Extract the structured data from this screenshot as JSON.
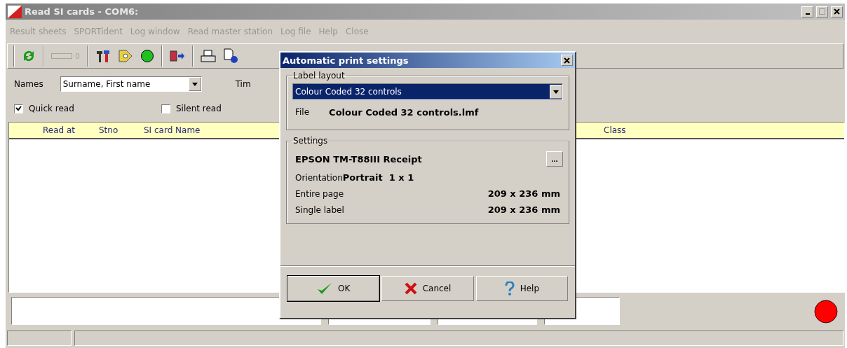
{
  "window": {
    "title": "Read SI cards - COM6:"
  },
  "menu": [
    "Result sheets",
    "SPORTident",
    "Log window",
    "Read master station",
    "Log file",
    "Help",
    "Close"
  ],
  "toolbar": {
    "counter": "0"
  },
  "options": {
    "names_label": "Names",
    "names_value": "Surname, First name",
    "time_label": "Tim",
    "checkboxes": [
      {
        "label": "Quick read",
        "checked": true
      },
      {
        "label": "Silent read",
        "checked": false
      }
    ]
  },
  "table": {
    "columns": [
      "Read at",
      "Stno",
      "SI card Name",
      "Class"
    ]
  },
  "status_light": {
    "color": "#ff0000"
  },
  "dialog": {
    "title": "Automatic print settings",
    "label_layout": {
      "legend": "Label layout",
      "value": "Colour Coded 32 controls",
      "file_label": "File",
      "file_value": "Colour Coded 32 controls.lmf"
    },
    "settings": {
      "legend": "Settings",
      "printer": "EPSON TM-T88III Receipt",
      "browse": "...",
      "orientation_label": "Orientation",
      "orientation_value": "Portrait  1 x 1",
      "rows": [
        {
          "label": "Entire page",
          "value": "209 x 236 mm"
        },
        {
          "label": "Single label",
          "value": "209 x 236 mm"
        }
      ]
    },
    "buttons": [
      {
        "kind": "ok",
        "label": "OK"
      },
      {
        "kind": "cancel",
        "label": "Cancel"
      },
      {
        "kind": "help",
        "label": "Help"
      }
    ]
  }
}
